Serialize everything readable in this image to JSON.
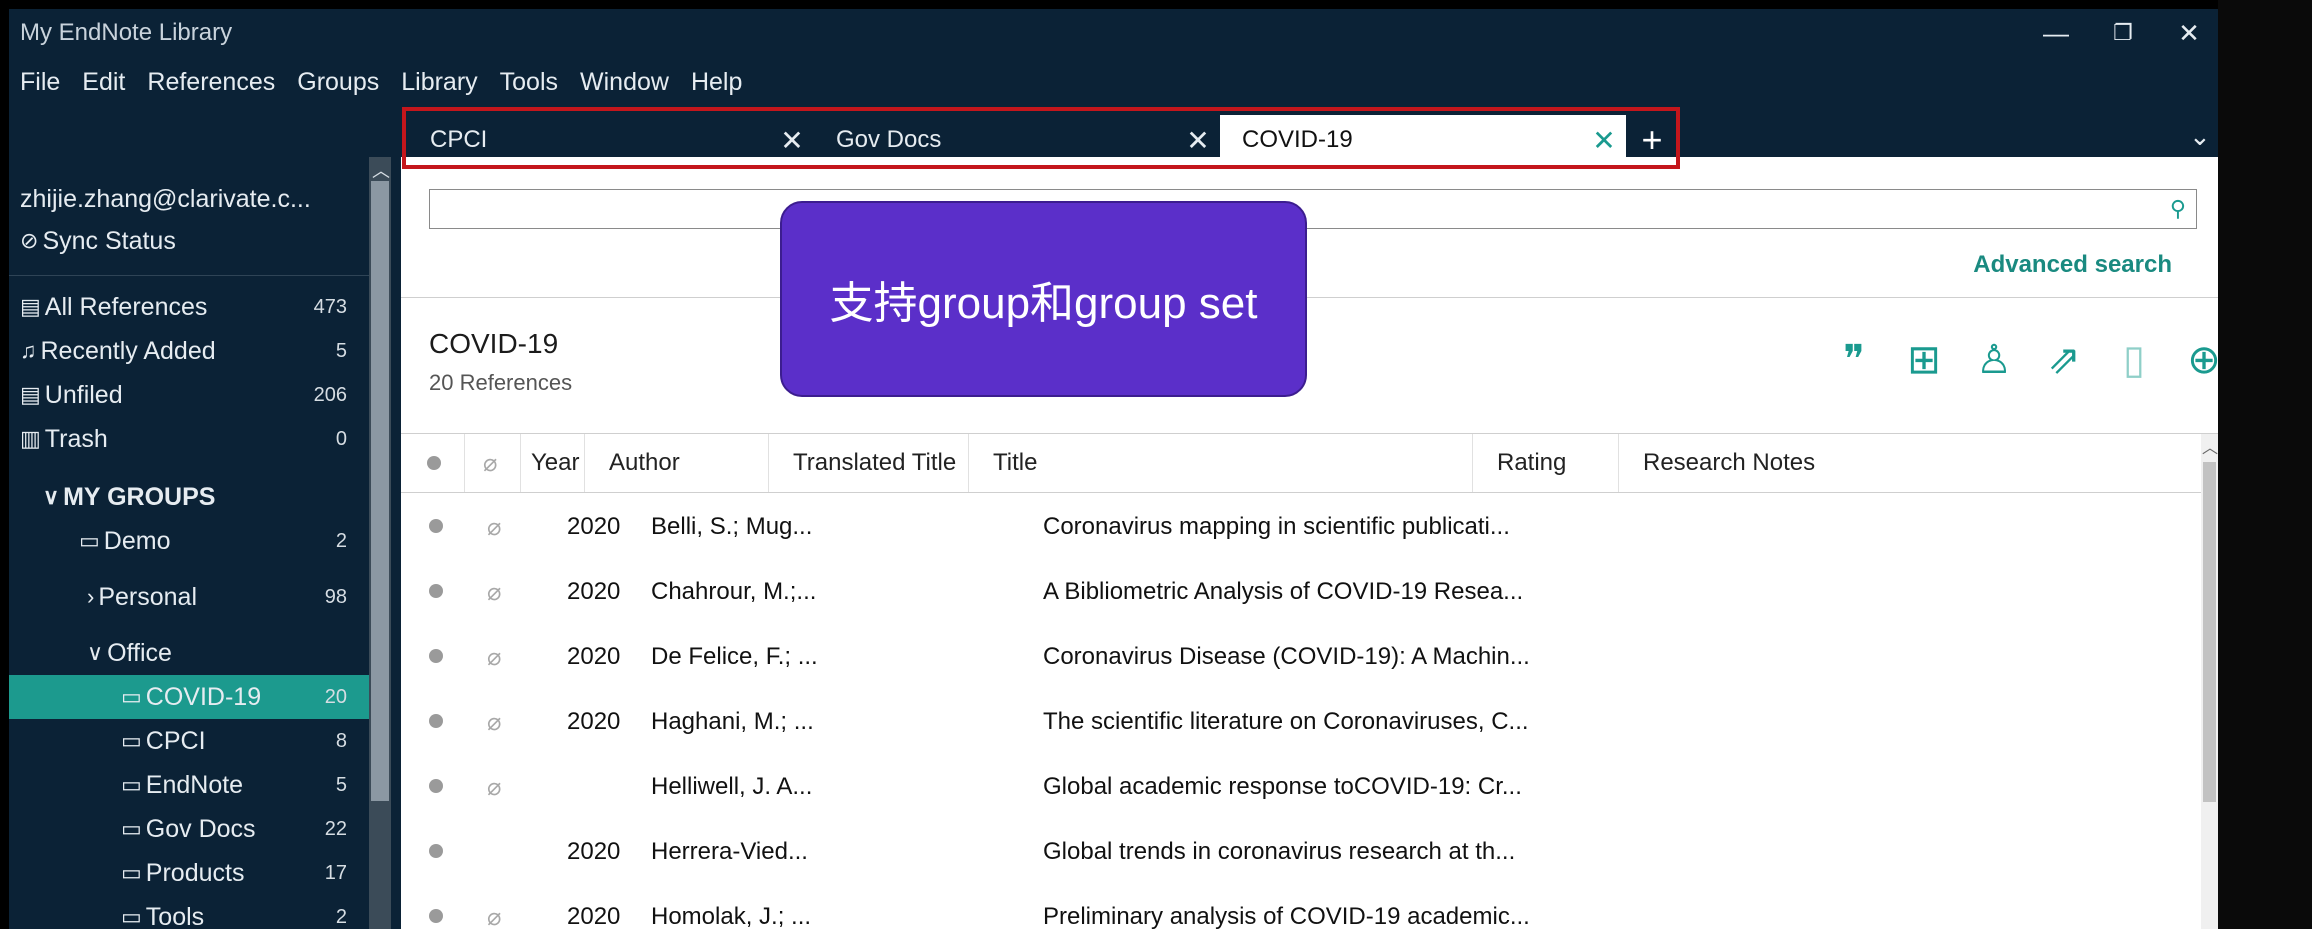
{
  "window": {
    "title": "My EndNote Library",
    "controls": [
      "—",
      "❐",
      "✕"
    ]
  },
  "menu": [
    "File",
    "Edit",
    "References",
    "Groups",
    "Library",
    "Tools",
    "Window",
    "Help"
  ],
  "tabs": [
    {
      "label": "CPCI",
      "close": "✕"
    },
    {
      "label": "Gov Docs",
      "close": "✕"
    },
    {
      "label": "COVID-19",
      "close": "✕"
    }
  ],
  "tab_add": "+",
  "tab_overflow": "⌄",
  "sidebar": {
    "account": "zhijie.zhang@clarivate.c...",
    "sync_status": "Sync Status",
    "items": [
      {
        "label": "All References",
        "count": "473"
      },
      {
        "label": "Recently Added",
        "count": "5"
      },
      {
        "label": "Unfiled",
        "count": "206"
      },
      {
        "label": "Trash",
        "count": "0"
      }
    ],
    "my_groups_label": "MY GROUPS",
    "groups": [
      {
        "label": "Demo",
        "count": "2"
      },
      {
        "label": "Personal",
        "count": "98"
      },
      {
        "label": "Office",
        "count": ""
      },
      {
        "label": "COVID-19",
        "count": "20"
      },
      {
        "label": "CPCI",
        "count": "8"
      },
      {
        "label": "EndNote",
        "count": "5"
      },
      {
        "label": "Gov Docs",
        "count": "22"
      },
      {
        "label": "Products",
        "count": "17"
      },
      {
        "label": "Tools",
        "count": "2"
      }
    ]
  },
  "main": {
    "search_placeholder": "",
    "advanced_search": "Advanced search",
    "group_title": "COVID-19",
    "group_count": "20 References",
    "columns": [
      "Year",
      "Author",
      "Translated Title",
      "Title",
      "Rating",
      "Research Notes"
    ],
    "rows": [
      {
        "year": "2020",
        "author": "Belli, S.; Mug...",
        "title": "Coronavirus mapping in scientific publicati...",
        "attachment": true
      },
      {
        "year": "2020",
        "author": "Chahrour, M.;...",
        "title": "A Bibliometric Analysis of COVID-19 Resea...",
        "attachment": true
      },
      {
        "year": "2020",
        "author": "De Felice, F.; ...",
        "title": "Coronavirus Disease (COVID-19): A Machin...",
        "attachment": true
      },
      {
        "year": "2020",
        "author": "Haghani, M.; ...",
        "title": "The scientific literature on Coronaviruses, C...",
        "attachment": true
      },
      {
        "year": "",
        "author": "Helliwell, J. A...",
        "title": "Global academic response toCOVID-19: Cr...",
        "attachment": true
      },
      {
        "year": "2020",
        "author": "Herrera-Vied...",
        "title": "Global trends in coronavirus research at th...",
        "attachment": false
      },
      {
        "year": "2020",
        "author": "Homolak, J.; ...",
        "title": "Preliminary analysis of COVID-19 academic...",
        "attachment": true
      }
    ]
  },
  "callout": "支持group和group set",
  "colors": {
    "app_bg": "#0b2236",
    "accent": "#1c9a8e",
    "callout_bg": "#5b2fc9",
    "highlight_box": "#c4161c"
  }
}
